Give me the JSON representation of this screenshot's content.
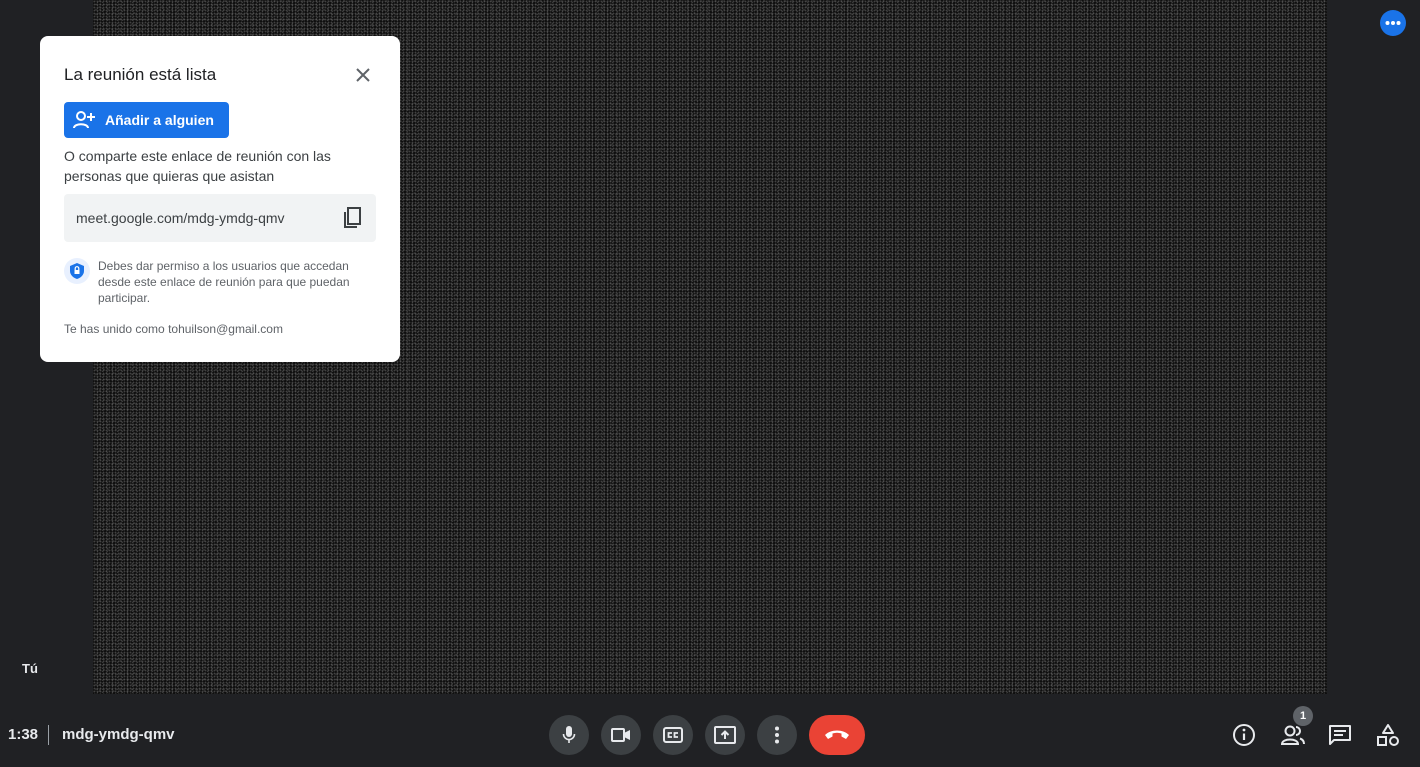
{
  "dialog": {
    "title": "La reunión está lista",
    "add_button_label": "Añadir a alguien",
    "share_text": "O comparte este enlace de reunión con las personas que quieras que asistan",
    "meeting_link": "meet.google.com/mdg-ymdg-qmv",
    "permission_text": "Debes dar permiso a los usuarios que accedan desde este enlace de reunión para que puedan participar.",
    "joined_as": "Te has unido como tohuilson@gmail.com"
  },
  "self_tile": {
    "label": "Tú"
  },
  "bottom_bar": {
    "time": "1:38",
    "meeting_code": "mdg-ymdg-qmv",
    "participants_count": "1"
  },
  "colors": {
    "accent": "#1a73e8",
    "hangup": "#ea4335",
    "background": "#202124",
    "control": "#3c4043"
  },
  "icons": [
    "close-icon",
    "add-person-icon",
    "copy-icon",
    "shield-icon",
    "more-horizontal-icon",
    "microphone-icon",
    "camera-icon",
    "captions-icon",
    "present-screen-icon",
    "more-vertical-icon",
    "hang-up-icon",
    "info-icon",
    "people-icon",
    "chat-icon",
    "activities-icon"
  ]
}
